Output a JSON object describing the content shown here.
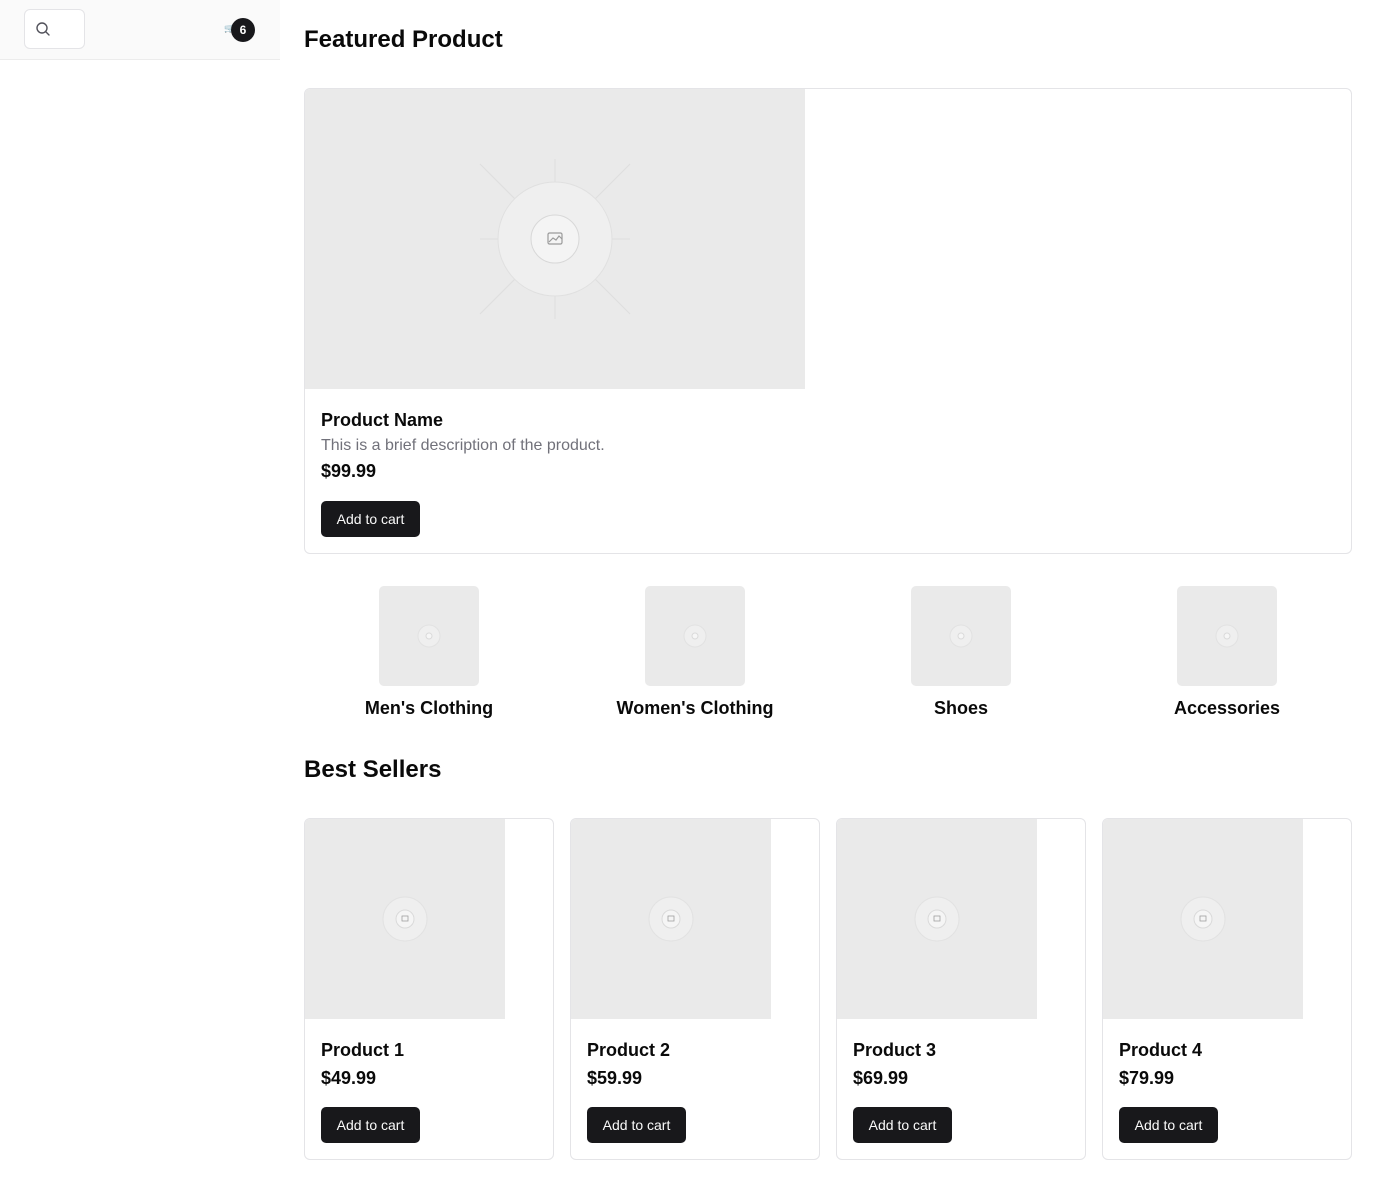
{
  "header": {
    "search_icon": "search-icon",
    "cart_icon": "cart-icon",
    "cart_icon_glyph": "🛒",
    "cart_count": "6"
  },
  "featured": {
    "title": "Featured Product",
    "product": {
      "name": "Product Name",
      "description": "This is a brief description of the product.",
      "price": "$99.99",
      "button_label": "Add to cart",
      "image_icon": "image-placeholder-icon"
    }
  },
  "categories": [
    {
      "name": "Men's Clothing"
    },
    {
      "name": "Women's Clothing"
    },
    {
      "name": "Shoes"
    },
    {
      "name": "Accessories"
    }
  ],
  "best_sellers": {
    "title": "Best Sellers",
    "products": [
      {
        "name": "Product 1",
        "price": "$49.99",
        "button_label": "Add to cart"
      },
      {
        "name": "Product 2",
        "price": "$59.99",
        "button_label": "Add to cart"
      },
      {
        "name": "Product 3",
        "price": "$69.99",
        "button_label": "Add to cart"
      },
      {
        "name": "Product 4",
        "price": "$79.99",
        "button_label": "Add to cart"
      }
    ]
  },
  "colors": {
    "primary_button": "#18181b",
    "placeholder_bg": "#eaeaea",
    "border": "#e4e4e7",
    "muted_text": "#71717a"
  }
}
